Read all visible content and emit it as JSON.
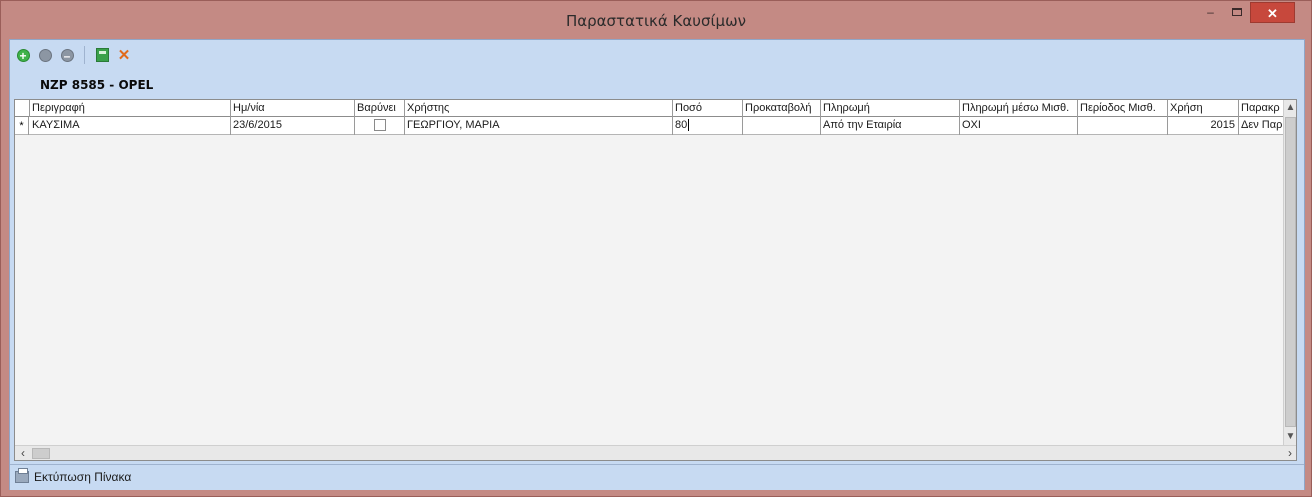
{
  "window": {
    "title": "Παραστατικά Καυσίμων",
    "controls": {
      "minimize": "–",
      "maximize": "□",
      "close": "✕"
    }
  },
  "toolbar": {
    "icons": [
      "add-icon",
      "edit-icon",
      "delete-icon",
      "save-icon",
      "tools-icon"
    ]
  },
  "vehicle_label": "NZP 8585 - OPEL",
  "table": {
    "columns": [
      "Περιγραφή",
      "Ημ/νία",
      "Βαρύνει",
      "Χρήστης",
      "Ποσό",
      "Προκαταβολή",
      "Πληρωμή",
      "Πληρωμή μέσω Μισθ.",
      "Περίοδος Μισθ.",
      "Χρήση",
      "Παρακρ"
    ],
    "rows": [
      {
        "marker": "*",
        "description": "ΚΑΥΣΙΜΑ",
        "date": "23/6/2015",
        "charged": false,
        "user": "ΓΕΩΡΓΙΟΥ, ΜΑΡΙΑ",
        "amount": "80",
        "advance": "",
        "payment": "Από την Εταιρία",
        "payroll_payment": "ΟΧΙ",
        "payroll_period": "",
        "usage": "2015",
        "note": "Δεν Παρ"
      }
    ]
  },
  "statusbar": {
    "print_label": "Εκτύπωση Πίνακα"
  }
}
